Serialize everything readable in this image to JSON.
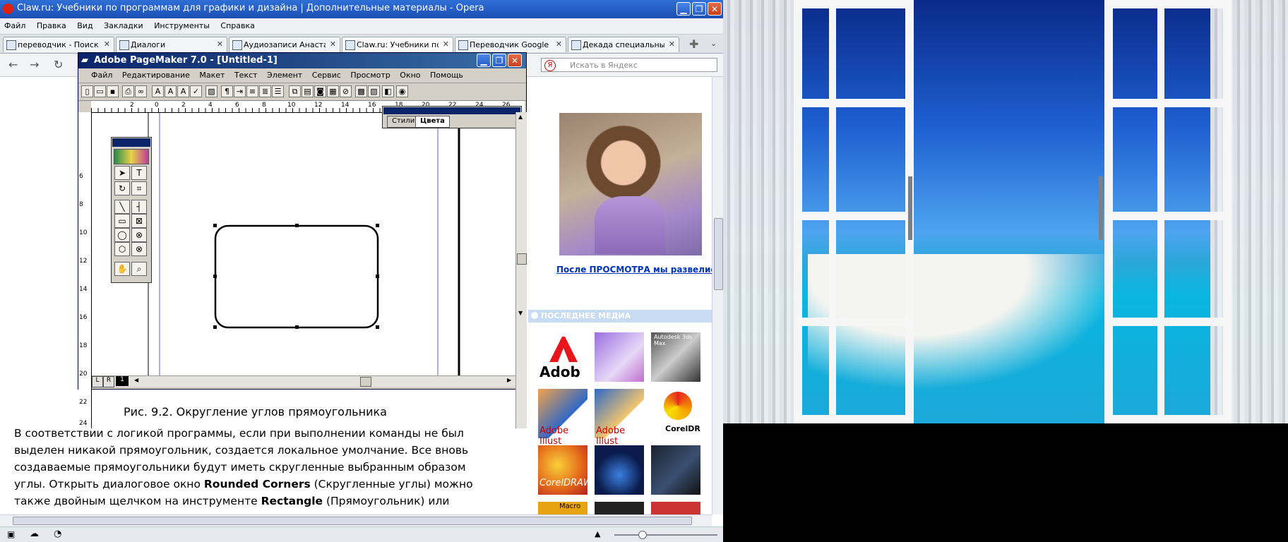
{
  "opera": {
    "title": "Claw.ru: Учебники по программам для графики и дизайна | Дополнительные материалы - Opera",
    "menu": [
      "Файл",
      "Правка",
      "Вид",
      "Закладки",
      "Инструменты",
      "Справка"
    ],
    "tabs": [
      {
        "label": "переводчик - Поиск ..."
      },
      {
        "label": "Диалоги"
      },
      {
        "label": "Аудиозаписи Анаста..."
      },
      {
        "label": "Claw.ru: Учебники по..."
      },
      {
        "label": "Переводчик Google"
      },
      {
        "label": "Декада специальных ..."
      }
    ],
    "search_placeholder": "Искать в Яндекс",
    "close_glyph": "✕"
  },
  "article": {
    "caption_prefix": "Рис. 9.2.",
    "caption_text": " Округление углов прямоугольника",
    "p1": "В соответствии с логикой программы, если при выполнении команды не был выделен никакой прямоугольник, создается локальное умолчание. Все вновь создаваемые прямоугольники будут иметь скругленные выбранным образом углы. Открыть диалоговое окно ",
    "b1": "Rounded Corners",
    "p2": " (Скругленные углы) можно также двойным щелчком на инструменте ",
    "b2": "Rectangle",
    "p3": " (Прямоугольник) или"
  },
  "sidebar": {
    "link": "После ПРОСМОТРА мы развелись",
    "media_heading": "ПОСЛЕДНЕЕ МЕДИА",
    "thumb_labels": [
      "Adob",
      "Autodesk 3ds Max",
      "Adobe Illust",
      "Adobe Illust",
      "CorelDR",
      "CorelDRAW",
      "Macro"
    ]
  },
  "pagemaker": {
    "title": "Adobe PageMaker 7.0 - [Untitled-1]",
    "menu": [
      "Файл",
      "Редактирование",
      "Макет",
      "Текст",
      "Элемент",
      "Сервис",
      "Просмотр",
      "Окно",
      "Помощь"
    ],
    "palette_tabs": [
      "Стили",
      "Цвета"
    ],
    "page_tabs": [
      "L",
      "R",
      "1"
    ],
    "ruler_h": [
      "2",
      "0",
      "2",
      "4",
      "6",
      "8",
      "10",
      "12",
      "14",
      "16",
      "18",
      "20",
      "22",
      "24",
      "26"
    ],
    "ruler_v": [
      "6",
      "8",
      "10",
      "12",
      "14",
      "16",
      "18",
      "20",
      "22",
      "24"
    ]
  },
  "colors": {
    "opera_title": "#1c4fb4",
    "pm_title": "#0a246a",
    "link": "#0033bb",
    "media_head": "#c7dcf2"
  }
}
